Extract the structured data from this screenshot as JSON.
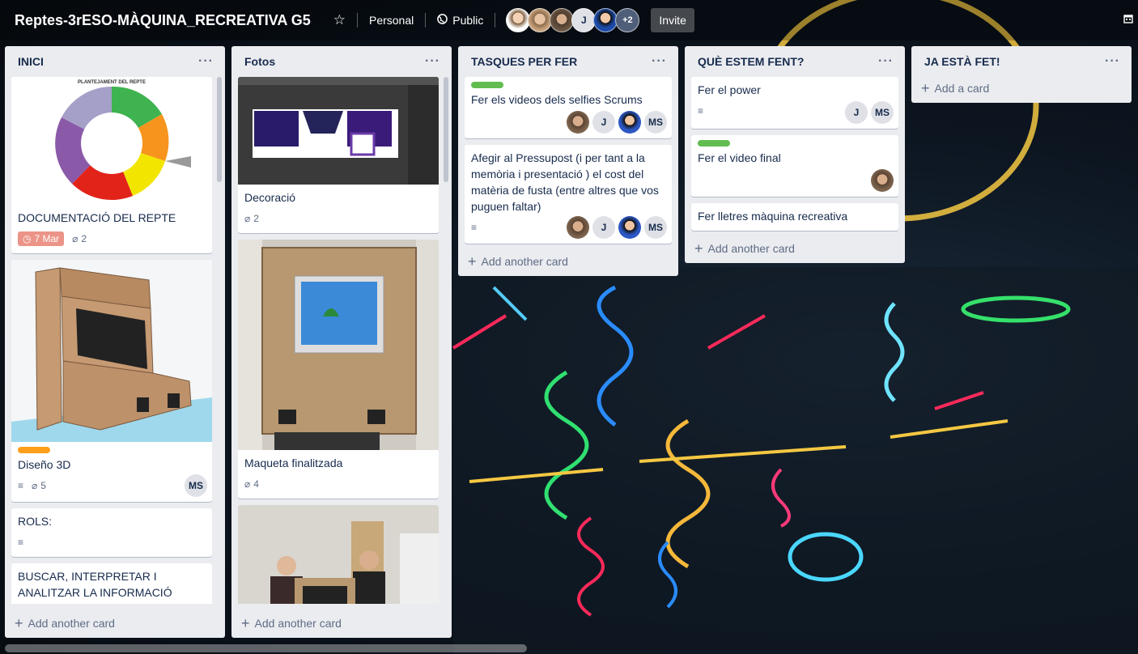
{
  "header": {
    "board_title": "Reptes-3rESO-MÀQUINA_RECREATIVA G5",
    "workspace": "Personal",
    "visibility": "Public",
    "member_initial": "J",
    "extra_members": "+2",
    "invite": "Invite"
  },
  "lists": [
    {
      "title": "INICI",
      "cards": [
        {
          "title": "DOCUMENTACIÓ DEL REPTE",
          "due": "7 Mar",
          "attachments": "2",
          "cover_text": "PLANTEJAMENT DEL REPTE"
        },
        {
          "title": "Diseño 3D",
          "label_color": "#ff9f1a",
          "attachments": "5",
          "member": "MS"
        },
        {
          "title": "ROLS:"
        },
        {
          "title": "BUSCAR, INTERPRETAR I ANALITZAR LA INFORMACIÓ"
        }
      ],
      "add": "Add another card"
    },
    {
      "title": "Fotos",
      "cards": [
        {
          "title": "Decoració",
          "attachments": "2"
        },
        {
          "title": "Maqueta finalitzada",
          "attachments": "4"
        },
        {
          "title": ""
        }
      ],
      "add": "Add another card"
    },
    {
      "title": "TASQUES PER FER",
      "cards": [
        {
          "title": "Fer els videos dels selfies Scrums",
          "label_color": "#61bd4f",
          "member_j": "J",
          "member_ms": "MS"
        },
        {
          "title": "Afegir al Pressupost (i per tant a la memòria i presentació ) el cost del matèria de fusta (entre altres que vos puguen faltar)",
          "member_j": "J",
          "member_ms": "MS"
        }
      ],
      "add": "Add another card"
    },
    {
      "title": "QUÈ ESTEM FENT?",
      "cards": [
        {
          "title": "Fer el power",
          "member_j": "J",
          "member_ms": "MS"
        },
        {
          "title": "Fer el video final",
          "label_color": "#61bd4f"
        },
        {
          "title": "Fer lletres màquina recreativa"
        }
      ],
      "add": "Add another card"
    },
    {
      "title": "JA ESTÀ FET!",
      "add": "Add a card"
    }
  ]
}
